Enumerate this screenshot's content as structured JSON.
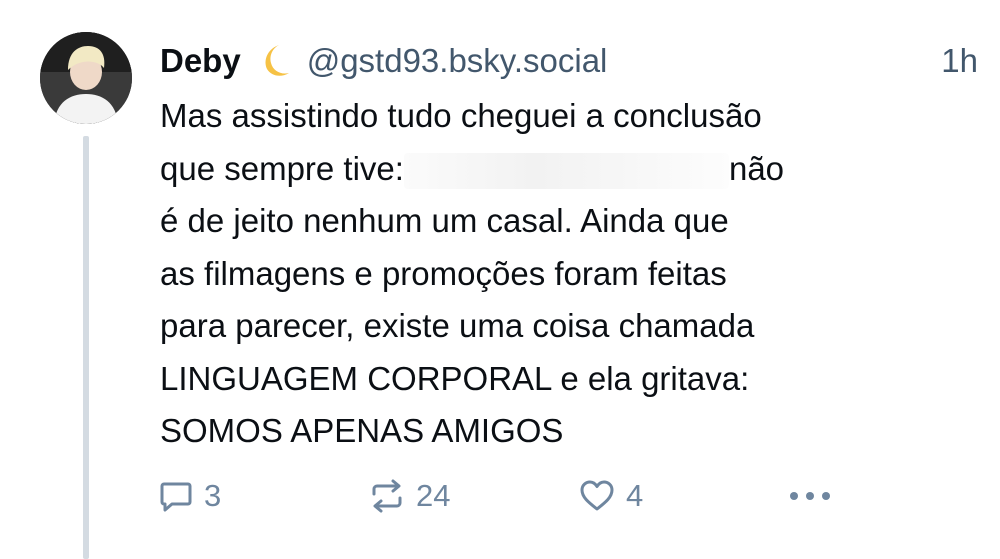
{
  "post": {
    "author": {
      "display_name": "Deby",
      "emoji": "moon-icon",
      "handle": "@gstd93.bsky.social"
    },
    "timestamp": "1h",
    "text_lines": [
      "Mas assistindo tudo cheguei a conclusão",
      "não",
      "é de jeito nenhum um casal. Ainda que",
      "as filmagens e promoções foram feitas",
      "para parecer, existe uma coisa chamada",
      "LINGUAGEM CORPORAL e ela gritava:",
      "SOMOS APENAS AMIGOS"
    ],
    "text_line2_prefix": "que sempre tive:",
    "actions": {
      "reply_count": "3",
      "repost_count": "24",
      "like_count": "4"
    }
  },
  "colors": {
    "text": "#0b0f14",
    "muted": "#42576c",
    "icon": "#6f869f",
    "thread_line": "#d4dbe2",
    "moon": "#f6c245"
  }
}
